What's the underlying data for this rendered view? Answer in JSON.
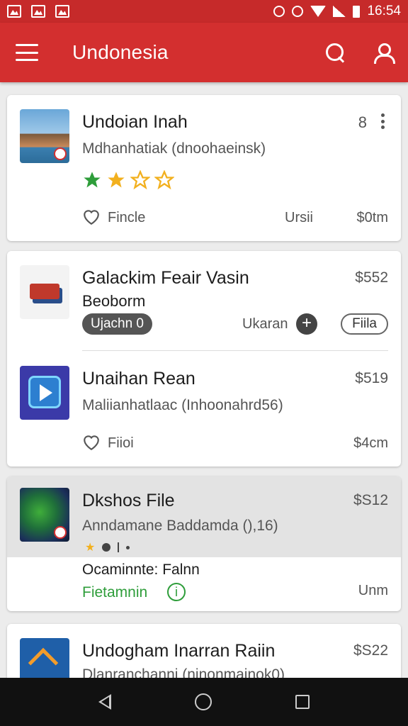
{
  "toolbar": {
    "title": "Undonesia"
  },
  "status_bar": {
    "time": "16:54"
  },
  "listings": [
    {
      "title": "Undoian Inah",
      "subtitle": "Mdhanhatiak (dnoohaeinsk)",
      "count": "8",
      "rating_stars": 2,
      "favorite_label": "Fincle",
      "meta": "Ursii",
      "price": "$0tm"
    },
    {
      "title": "Galackim Feair Vasin",
      "subtitle": "Beoborm",
      "price": "$552",
      "tag": "Ujachn 0",
      "action_label": "Ukaran",
      "button_label": "Fiila"
    },
    {
      "title": "Unaihan Rean",
      "subtitle": "Maliianhatlaac (Inhoonahrd56)",
      "price": "$519",
      "favorite_label": "Fiioi",
      "meta_price": "$4cm"
    },
    {
      "title": "Dkshos File",
      "subtitle": "Anndamane Baddamda (),16)",
      "price": "$S12",
      "note": "Ocaminnte: Falnn",
      "status_label": "Fietamnin",
      "meta": "Unm"
    },
    {
      "title": "Undogham Inarran Raiin",
      "subtitle": "Dlanranchanni (ninonmainok0)",
      "price": "$S22"
    }
  ],
  "colors": {
    "brand": "#d32f2f",
    "positive": "#2e9d3a",
    "star": "#f2b01e"
  },
  "icons": [
    "menu-icon",
    "search-icon",
    "account-icon",
    "more-vert-icon",
    "heart-icon",
    "plus-circle-icon",
    "info-icon",
    "back-icon",
    "home-icon",
    "recents-icon"
  ]
}
